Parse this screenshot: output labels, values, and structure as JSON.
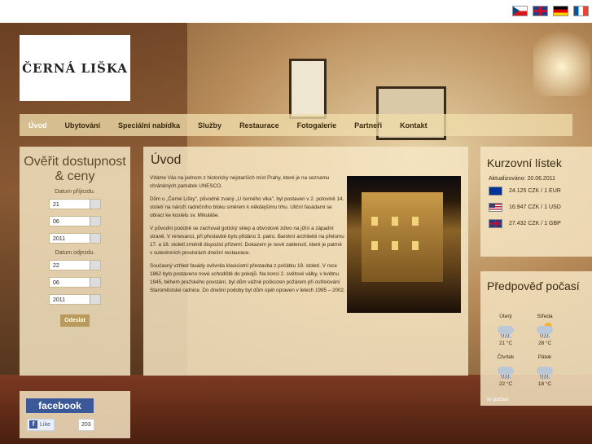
{
  "languages": [
    "cz-flag",
    "gb-flag",
    "de-flag",
    "fr-flag"
  ],
  "logo": {
    "text": "ČERNÁ LIŠKA"
  },
  "nav": {
    "items": [
      "Úvod",
      "Ubytování",
      "Speciální nabídka",
      "Služby",
      "Restaurace",
      "Fotogalerie",
      "Partneři",
      "Kontakt"
    ]
  },
  "availability": {
    "title": "Ověřit dostupnost & ceny",
    "arrival_label": "Datum příjezdu.",
    "arrival": {
      "day": "21",
      "month": "06",
      "year": "2011"
    },
    "departure_label": "Datum odjezdu.",
    "departure": {
      "day": "22",
      "month": "06",
      "year": "2011"
    },
    "submit": "Odeslat"
  },
  "facebook": {
    "logo": "facebook",
    "like": "Like",
    "count": "203"
  },
  "main": {
    "title": "Úvod",
    "paragraphs": [
      "Vítáme Vás na jednom z historicky nejstarších míst Prahy, které je na seznamu chráněných památek UNESCO.",
      "Dům u „Černé Lišky\", původně zvaný „U černého vlka\", byl postaven v 2. polovině 14. století na nároží radničního bloku směrem k někdejšímu trhu. Uliční fasádami se obrací ke kostelu sv. Mikuláše.",
      "V původní podobě se zachoval gotický sklep a obvodové zdivo na jižní a západní straně. V renesanci, při přestavbě bylo přidáno 3. patro. Barokní architekti na přelomu 17. a 18. století změnili dispozici přízemí. Dokazem je nově zaklenutí, které je patrné v suterénních prostorách dnešní restaurace.",
      "Současný vzhled fasády ovlivnila klasicistní přestavba z počátku 19. století. V roce 1862 bylo postaveno nové schodiště do pokojů. Na konci 2. světové války, v květnu 1945, během pražského povstání, byl dům vážně poškozen požárem při ostřelování Staroměstské radnice. Do dnešní podoby byl dům opět opraven v letech 1995 – 2002."
    ]
  },
  "rates": {
    "title": "Kurzovní lístek",
    "updated": "Aktualizováno: 20.06.2011",
    "items": [
      {
        "flag": "eu-flag",
        "text": "24.125 CZK / 1 EUR"
      },
      {
        "flag": "us-flag",
        "text": "16.947 CZK / 1 USD"
      },
      {
        "flag": "gb-flag",
        "text": "27.432 CZK / 1 GBP"
      }
    ]
  },
  "weather": {
    "title": "Předpověď počasí",
    "days": [
      {
        "day": "Úterý",
        "temp": "21 °C",
        "icon": "rain-cloud-icon"
      },
      {
        "day": "Středa",
        "temp": "28 °C",
        "icon": "sun-rain-icon"
      },
      {
        "day": "Čtvrtek",
        "temp": "22 °C",
        "icon": "rain-cloud-icon"
      },
      {
        "day": "Pátek",
        "temp": "18 °C",
        "icon": "rain-cloud-icon"
      }
    ],
    "link": "In-počasí"
  }
}
